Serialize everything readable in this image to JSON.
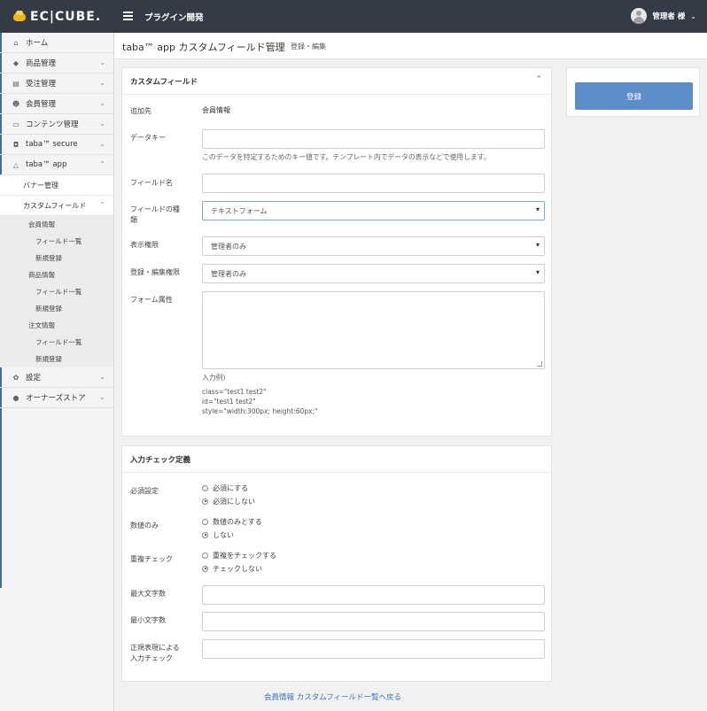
{
  "header": {
    "logo_text": "EC|CUBE.",
    "plugin_title": "プラグイン開発",
    "user_name": "管理者 様",
    "user_chevron": "⌄"
  },
  "sidebar": {
    "items": [
      {
        "label": "ホーム",
        "icon": "home-icon",
        "glyph": "⌂"
      },
      {
        "label": "商品管理",
        "icon": "tag-icon",
        "glyph": "◆",
        "chevron": "⌄"
      },
      {
        "label": "受注管理",
        "icon": "cart-icon",
        "glyph": "▤",
        "chevron": "⌄"
      },
      {
        "label": "会員管理",
        "icon": "users-icon",
        "glyph": "☻",
        "chevron": "⌄"
      },
      {
        "label": "コンテンツ管理",
        "icon": "file-icon",
        "glyph": "▭",
        "chevron": "⌄"
      },
      {
        "label": "taba™ secure",
        "icon": "shield-icon",
        "glyph": "◘",
        "chevron": "⌄"
      },
      {
        "label": "taba™ app",
        "icon": "flask-icon",
        "glyph": "△",
        "chevron": "⌃"
      }
    ],
    "sub_items": [
      {
        "label": "バナー管理"
      },
      {
        "label": "カスタムフィールド",
        "chevron": "⌃"
      }
    ],
    "subsub_items": [
      {
        "label": "会員情報",
        "indent": 1
      },
      {
        "label": "フィールド一覧",
        "indent": 2
      },
      {
        "label": "新規登録",
        "indent": 2
      },
      {
        "label": "商品情報",
        "indent": 1
      },
      {
        "label": "フィールド一覧",
        "indent": 2
      },
      {
        "label": "新規登録",
        "indent": 2
      },
      {
        "label": "注文情報",
        "indent": 1
      },
      {
        "label": "フィールド一覧",
        "indent": 2
      },
      {
        "label": "新規登録",
        "indent": 2
      }
    ],
    "bottom_items": [
      {
        "label": "設定",
        "icon": "gear-icon",
        "glyph": "✿",
        "chevron": "⌄"
      },
      {
        "label": "オーナーズストア",
        "icon": "info-icon",
        "glyph": "●",
        "chevron": "⌄"
      }
    ]
  },
  "page": {
    "title": "taba™ app カスタムフィールド管理",
    "subtitle": "登録・編集"
  },
  "custom_field": {
    "title": "カスタムフィールド",
    "collapse_glyph": "⌃",
    "target_label": "追加先",
    "target_value": "会員情報",
    "data_key_label": "データキー",
    "data_key_value": "",
    "data_key_help": "このデータを特定するためのキー値です。テンプレート内でデータの表示などで使用します。",
    "field_name_label": "フィールド名",
    "field_name_value": "",
    "field_type_label_1": "フィールドの種",
    "field_type_label_2": "類",
    "field_type_value": "テキストフォーム",
    "read_perm_label": "表示権限",
    "read_perm_value": "管理者のみ",
    "write_perm_label": "登録・編集権限",
    "write_perm_value": "管理者のみ",
    "attr_label": "フォーム属性",
    "attr_value": "",
    "example_title": "入力例)",
    "example_1": "class=\"test1 test2\"",
    "example_2": "id=\"test1 test2\"",
    "example_3": "style=\"width:300px; height:60px;\""
  },
  "validation": {
    "title": "入力チェック定義",
    "required_label": "必須設定",
    "required_opt1": "必須にする",
    "required_opt2": "必須にしない",
    "numeric_label": "数値のみ",
    "numeric_opt1": "数値のみとする",
    "numeric_opt2": "しない",
    "dup_label": "重複チェック",
    "dup_opt1": "重複をチェックする",
    "dup_opt2": "チェックしない",
    "max_label": "最大文字数",
    "max_value": "",
    "min_label": "最小文字数",
    "min_value": "",
    "regex_label_1": "正規表現による",
    "regex_label_2": "入力チェック",
    "regex_value": ""
  },
  "actions": {
    "register_label": "登録",
    "back_link": "会員情報 カスタムフィールド一覧へ戻る"
  }
}
